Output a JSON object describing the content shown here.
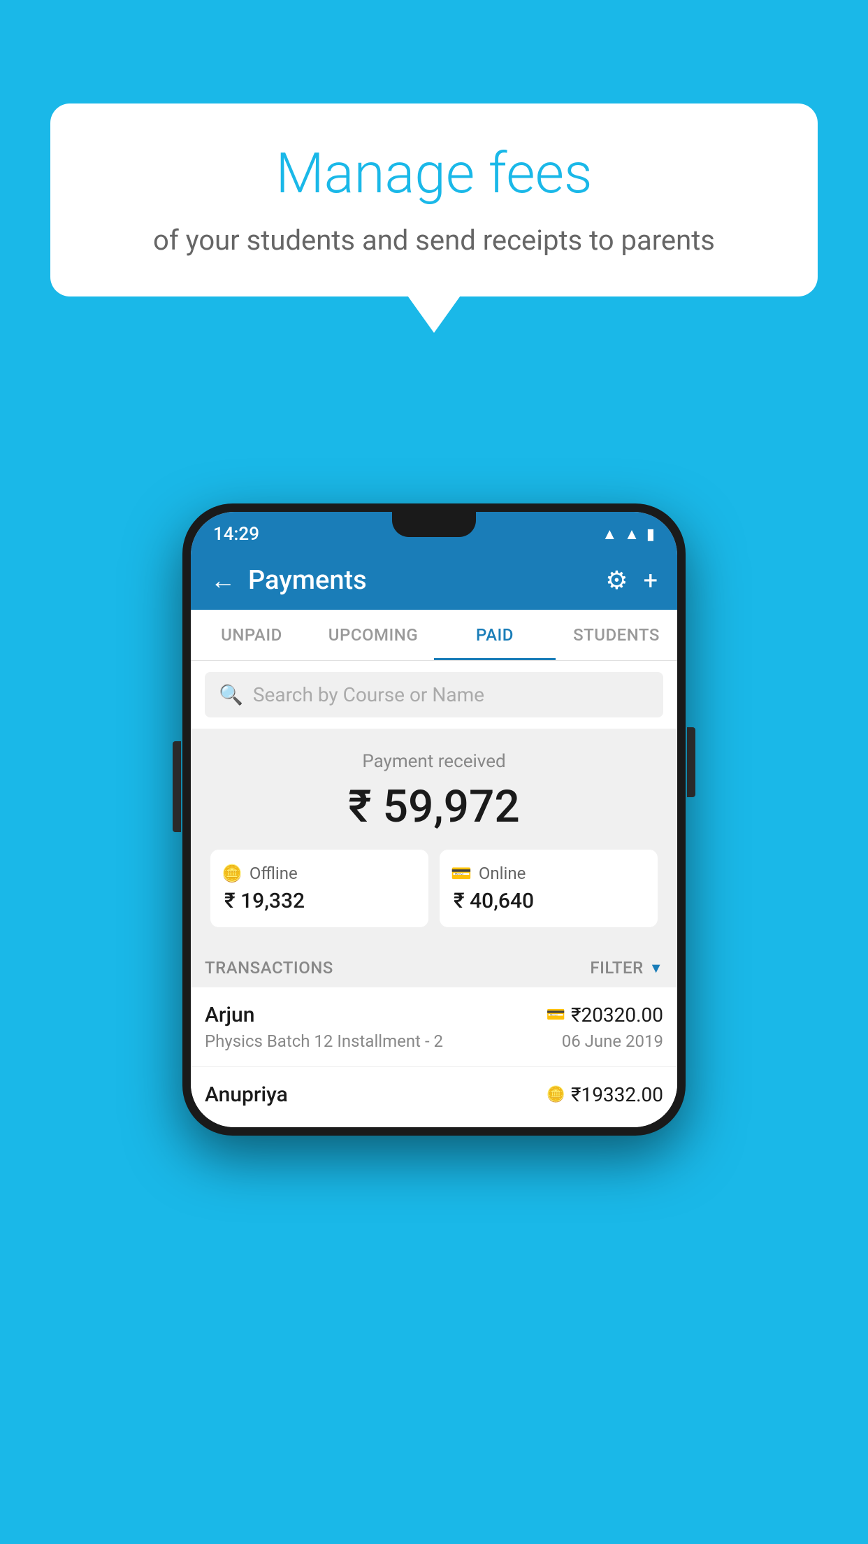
{
  "background_color": "#1ab8e8",
  "bubble": {
    "title": "Manage fees",
    "subtitle": "of your students and send receipts to parents"
  },
  "status_bar": {
    "time": "14:29",
    "icons": [
      "wifi",
      "signal",
      "battery"
    ]
  },
  "header": {
    "title": "Payments",
    "back_label": "←",
    "gear_label": "⚙",
    "plus_label": "+"
  },
  "tabs": [
    {
      "label": "UNPAID",
      "active": false
    },
    {
      "label": "UPCOMING",
      "active": false
    },
    {
      "label": "PAID",
      "active": true
    },
    {
      "label": "STUDENTS",
      "active": false
    }
  ],
  "search": {
    "placeholder": "Search by Course or Name"
  },
  "payment_summary": {
    "label": "Payment received",
    "amount": "₹ 59,972",
    "offline_label": "Offline",
    "offline_amount": "₹ 19,332",
    "online_label": "Online",
    "online_amount": "₹ 40,640"
  },
  "transactions": {
    "label": "TRANSACTIONS",
    "filter_label": "FILTER",
    "rows": [
      {
        "name": "Arjun",
        "amount": "₹20320.00",
        "detail": "Physics Batch 12 Installment - 2",
        "date": "06 June 2019",
        "icon": "card"
      },
      {
        "name": "Anupriya",
        "amount": "₹19332.00",
        "detail": "",
        "date": "",
        "icon": "rupee"
      }
    ]
  }
}
